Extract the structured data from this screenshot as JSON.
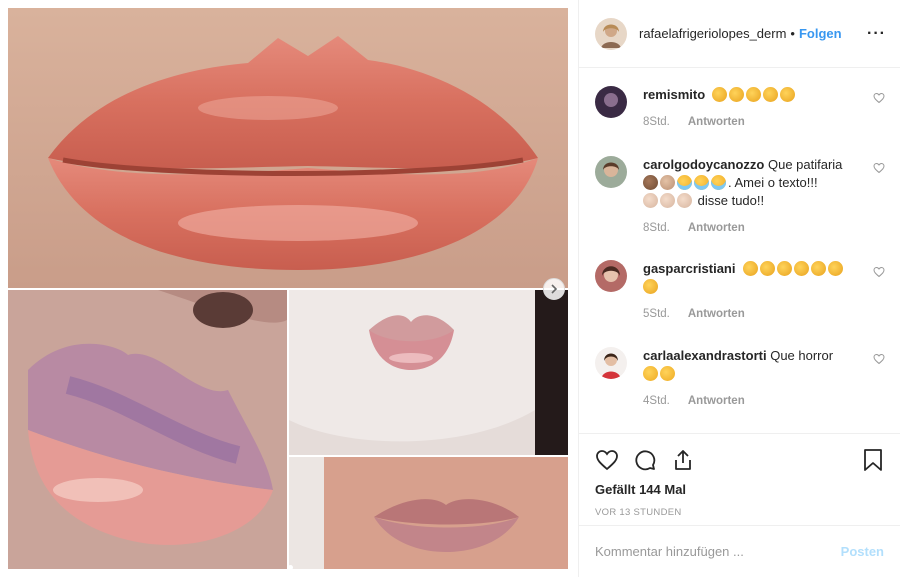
{
  "post": {
    "username": "rafaelafrigeriolopes_derm",
    "separator": "•",
    "follow_label": "Folgen",
    "more_label": "···"
  },
  "comments": [
    {
      "username": "remismito",
      "text": "",
      "emoji_after": [
        "clap",
        "clap",
        "clap",
        "clap",
        "clap"
      ],
      "time": "8Std.",
      "reply_label": "Antworten"
    },
    {
      "username": "carolgodoycanozzo",
      "text": "Que patifaria",
      "emoji_line": [
        "monkey",
        "facepalm",
        "laugh",
        "laugh",
        "laugh"
      ],
      "text2": ". Amei o texto!!!",
      "emoji_line2": [
        "clap-l",
        "clap-l",
        "clap-l"
      ],
      "text3": "disse tudo!!",
      "time": "8Std.",
      "reply_label": "Antworten"
    },
    {
      "username": "gasparcristiani",
      "text": "",
      "emoji_after": [
        "clap",
        "clap",
        "clap",
        "clap",
        "clap",
        "clap",
        "clap"
      ],
      "time": "5Std.",
      "reply_label": "Antworten"
    },
    {
      "username": "carlaalexandrastorti",
      "text": "Que horror",
      "emoji_after": [
        "wow",
        "wow"
      ],
      "time": "4Std.",
      "reply_label": "Antworten"
    }
  ],
  "likes_text": "Gefällt 144 Mal",
  "time_ago": "VOR 13 STUNDEN",
  "comment_input": {
    "placeholder": "Kommentar hinzufügen ...",
    "post_label": "Posten"
  },
  "colors": {
    "link_blue": "#3897f0",
    "post_disabled": "#b2dffc",
    "meta_gray": "#999999",
    "text": "#262626"
  }
}
